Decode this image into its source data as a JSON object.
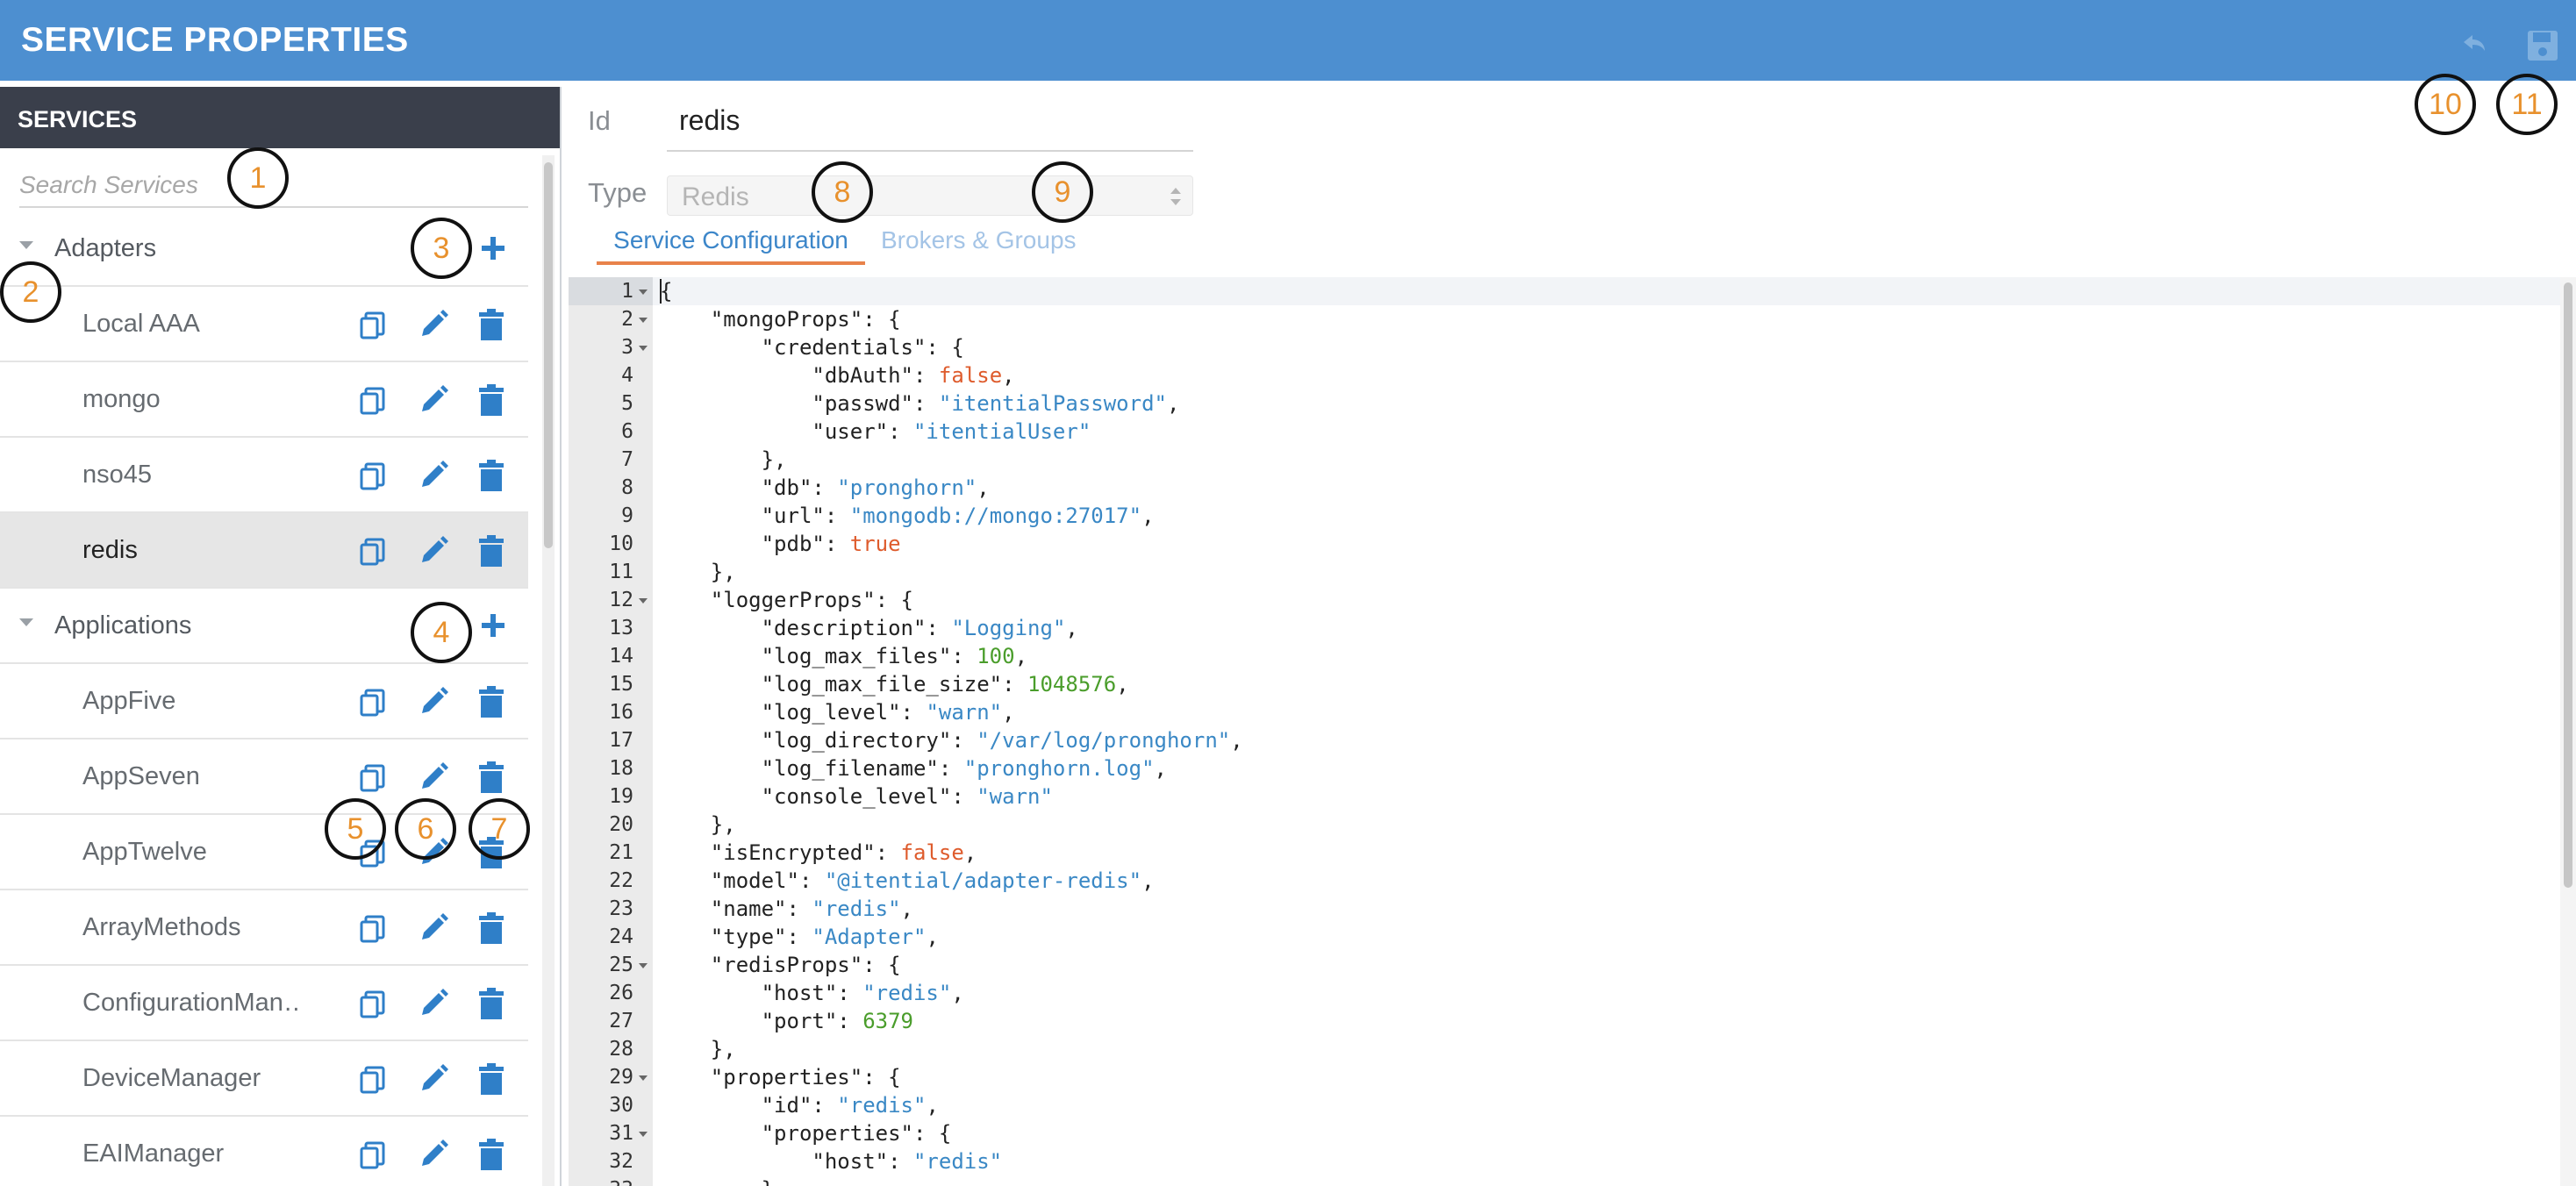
{
  "header": {
    "title": "SERVICE PROPERTIES",
    "undo_icon": "undo-icon",
    "save_icon": "save-icon"
  },
  "sidebar": {
    "title": "SERVICES",
    "search_placeholder": "Search Services",
    "groups": [
      {
        "label": "Adapters",
        "items": [
          "Local AAA",
          "mongo",
          "nso45",
          "redis"
        ]
      },
      {
        "label": "Applications",
        "items": [
          "AppFive",
          "AppSeven",
          "AppTwelve",
          "ArrayMethods",
          "ConfigurationMan…",
          "DeviceManager",
          "EAIManager"
        ]
      }
    ],
    "selected_item": "redis"
  },
  "form": {
    "id_label": "Id",
    "id_value": "redis",
    "type_label": "Type",
    "type_value": "Redis"
  },
  "tabs": {
    "active": "Service Configuration",
    "inactive": "Brokers & Groups"
  },
  "editor": {
    "lines": [
      "{",
      "    \"mongoProps\": {",
      "        \"credentials\": {",
      "            \"dbAuth\": false,",
      "            \"passwd\": \"itentialPassword\",",
      "            \"user\": \"itentialUser\"",
      "        },",
      "        \"db\": \"pronghorn\",",
      "        \"url\": \"mongodb://mongo:27017\",",
      "        \"pdb\": true",
      "    },",
      "    \"loggerProps\": {",
      "        \"description\": \"Logging\",",
      "        \"log_max_files\": 100,",
      "        \"log_max_file_size\": 1048576,",
      "        \"log_level\": \"warn\",",
      "        \"log_directory\": \"/var/log/pronghorn\",",
      "        \"log_filename\": \"pronghorn.log\",",
      "        \"console_level\": \"warn\"",
      "    },",
      "    \"isEncrypted\": false,",
      "    \"model\": \"@itential/adapter-redis\",",
      "    \"name\": \"redis\",",
      "    \"type\": \"Adapter\",",
      "    \"redisProps\": {",
      "        \"host\": \"redis\",",
      "        \"port\": 6379",
      "    },",
      "    \"properties\": {",
      "        \"id\": \"redis\",",
      "        \"properties\": {",
      "            \"host\": \"redis\"",
      "        }"
    ],
    "foldable_lines": [
      1,
      2,
      3,
      12,
      25,
      29,
      31
    ]
  },
  "callouts": [
    "1",
    "2",
    "3",
    "4",
    "5",
    "6",
    "7",
    "8",
    "9",
    "10",
    "11"
  ],
  "colors": {
    "header": "#4d8fd0",
    "sidebar_header": "#3a3f4b",
    "action_icon": "#2f7fc8",
    "callout_text": "#e8912d",
    "tab_underline": "#e8824a"
  }
}
